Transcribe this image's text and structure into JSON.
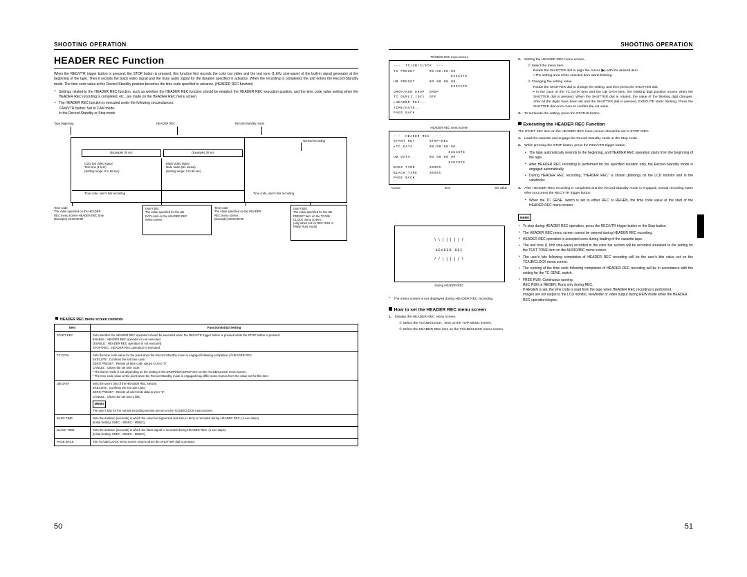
{
  "left": {
    "runhead": "SHOOTING OPERATION",
    "title": "HEADER REC Function",
    "intro": "When the REC/VTR trigger button is pressed, the STOP button is pressed, this function first records the color bar video and the test tone (1 kHz sine-wave) of the built-in signal generator at the beginning of the tape. Then it records the black video signal and the mute audio signal for the duration specified in advance. When the recording is completed, the unit enters the Record-Standby mode. The time code value at the Record-Standby position becomes the time code specified in advance. (HEADER REC function)",
    "bullets": [
      "Settings related to the HEADER REC function, such as whether the HEADER REC function should be enabled, the HEADER REC execution position, and the time code value setting when the HEADER REC recording is completed, etc., are made on the HEADER REC menu screen.",
      "The HEADER REC function is executed under the following circumstances:"
    ],
    "sub_conditions": [
      "CAM/VTR button: Set to CAM mode.",
      "In the Record-Standby or Stop mode"
    ],
    "diagram": {
      "tape_beginning": "Tape beginning",
      "header_rec": "HEADER REC",
      "record_standby": "Record-Standby mode",
      "normal_recording": "Normal recording",
      "example30a": "(Example) 30 sec",
      "example30b": "(Example) 30 sec",
      "colorbar": "Color bar video signal\nTest tone (1 kHz)\n(Setting range: 0 to 99 sec)",
      "black": "Black video signal\nMute audio (No sound)\n(Setting range: 0 to 99 sec)",
      "tc_ub_left": "Time code, user's bits recording",
      "tc_ub_right": "Time code, user's bits recording",
      "note1": "Time code:\nThe value specified on the HEADER\nREC menu screen-HEADER REC time\n(Example) 23:59:30:00",
      "note2": "User's bits:\nThe value specified for the UB\nDATA item on the HEADER REC\nmenu screen.",
      "note3": "Time code:\nThe value specified on the HEADER\nREC menu screen.\n(Example) 00:00:00:00",
      "note4": "User's bits:\nThe value specified for the UB\nPRESET item on the TC/UB/\nCLOCK menu screen.\n(only when set for REC RUN or\nFREE RUN mode)"
    },
    "table": {
      "heading": "HEADER REC menu screen contents",
      "cols": [
        "Item",
        "Function/Initial Setting"
      ],
      "rows": [
        {
          "item": "START KEY",
          "lines": [
            "Sets whether the HEADER REC operation should be executed when the REC/VTR trigger button is pressed while the STOP button is pressed.",
            "ENABLE            : HEADER REC operation is not executed.",
            "DISABLE           : HEADER REC operation is not executed.",
            "STOP+REC        : HEADER REC operation is executed."
          ]
        },
        {
          "item": "TC DATA",
          "lines": [
            "Sets the time code value for the point when the Record-Standby mode is engaged following completion of HEADER REC.",
            "EXECUTE         : Confirms the set time code.",
            "ZERO PRESET  : Resets all time code values to zero \"0\".",
            "CANCEL           : Clears the set time code.",
            "• The frame mode is set depending on the setting in the DROP/NON DROP item on the TC/UB/CLOCK menu screen.",
            "* The time code value at the point when the Record-Standby mode is engaged may differ some frames from the value set for this item."
          ]
        },
        {
          "item": "UB DATA",
          "lines": [
            "Sets the user's bits of the HEADER REC section.",
            "EXECUTE         : Confirms the set user's bits.",
            "ZERO PRESET  : Resets all user's bits data to zero \"0\".",
            "CANCEL           : Clears the set user's bits.",
            "MEMO",
            "The user's bits for the normal recording section are set on the TC/UB/CLOCK menu screen."
          ]
        },
        {
          "item": "BARS TIME",
          "lines": [
            "Sets the duration (seconds) in which the color bar signal and test tone (1 kHz) is recorded during HEADER REC. (1-sec steps)",
            "[Initial Setting: 0SEC - 30SEC - 99SEC]"
          ]
        },
        {
          "item": "BLACK TIME",
          "lines": [
            "Sets the duration (seconds) in which the black signal is recorded during HEADER REC. (1-sec steps)",
            "[Initial Setting: 0SEC - 30SEC - 99SEC]"
          ]
        },
        {
          "item": "PAGE BACK",
          "lines": [
            "The TC/UB/CLOCK menu screen returns when the SHUTTER dial is pressed."
          ]
        }
      ]
    },
    "folio": "50"
  },
  "right": {
    "runhead": "SHOOTING OPERATION",
    "screen1": {
      "caption": "TC/UB/CLOCK menu screen",
      "text": "---  TC/UB/CLOCK  ---\nTC PRESET      00:00:00:00\n                        EXECUTE\nUB PRESET      00 00 00 00\n                        EXECUTE\nDROP/NON DROP  DROP\nTC DUPLI.(DV)  OFF\n▸HEADER REC...\nTIME/DATE..\nPAGE BACK"
    },
    "screen2": {
      "caption": "HEADER REC menu screen",
      "text": "---  HEADER REC  ---\nSTART KEY      STOP+REC\n▸TC DATA       00:00:00:00\n                       EXECUTE\nUB DATA        00 00 00 00\n                       EXECUTE\nBARS TIME      30SEC\nBLACK TIME     30SEC\nPAGE BACK"
    },
    "screen_labels": {
      "cursor": "Cursor",
      "item": "Item",
      "setvalue": "Set value"
    },
    "viewfinder": {
      "text": "HEADER REC",
      "caption": "During HEADER REC"
    },
    "steps_left": [
      {
        "n": "2.",
        "text": "Setting the HEADER REC menu screen.",
        "subs": [
          {
            "c": "1",
            "t": "Select the menu item.",
            "lines": [
              "Rotate the SHUTTER dial to align the cursor (▶) with the desired item.",
              "• The setting area of the selected item starts blinking."
            ]
          },
          {
            "c": "2",
            "t": "Changing the setting value.",
            "lines": [
              "Rotate the SHUTTER dial to change the setting, and then press the SHUTTER dial.",
              "• In the case of the TC DATA item and the UB DATA item, the blinking digit position moves when the SHUTTER dial is pressed. When the SHUTTER dial is rotated, the value of the blinking digit changes. After all the digits have been set and the SHUTTER dial is pressed, EXECUTE starts blinking. Press the SHUTTER dial once more to confirm the set value."
            ]
          }
        ]
      },
      {
        "n": "3.",
        "text": "To terminate the setting, press the STATUS button.",
        "subs": []
      }
    ],
    "section1": {
      "heading": "Executing the HEADER REC Function",
      "intro": "The START KEY item on the HEADER REC menu screen should be set to STOP+REC.",
      "steps": [
        {
          "n": "1.",
          "text": "Load the cassette and engage the Record-Standby mode or the Stop mode.",
          "bullets": []
        },
        {
          "n": "2.",
          "text": "While pressing the STOP button, press the REC/VTR trigger button.",
          "bullets": [
            "The tape automatically rewinds to the beginning, and HEADER REC operation starts from the beginning of the tape.",
            "After HEADER REC recording is performed for the specified duration only, the Record-Standby mode is engaged automatically.",
            "During HEADER REC recording, \"HEADER REC\" is shown (blinking) on the LCD monitor and in the viewfinder."
          ]
        },
        {
          "n": "3.",
          "text": "After HEADER REC recording is completed and the Record-Standby mode is engaged, normal recording starts when you press the REC/VTR trigger button.",
          "bullets": [
            "When the TC GENE. switch is set to either REC or REGEN, the time code value at the start of the HEADER REC menu screen."
          ]
        }
      ]
    },
    "memo": {
      "title": "MEMO",
      "items": [
        "To stop during HEADER REC operation, press the REC/VTR trigger button or the Stop button.",
        "The HEADER REC menu screen cannot be opened during HEADER REC recording.",
        "HEADER REC operation is accepted even during loading of the cassette tape.",
        "The test tone (1 kHz sine-wave) recorded in the color bar section will be recorded unrelated to the setting for the TEST TONE item on the AUDIO/MIC menu screen.",
        "The user's bits following completion of HEADER REC recording will be the user's bits value set on the TC/UB/CLOCK menu screen.",
        "The running of the time code following completion of HEADER REC recording will be in accordance with the setting for the TC GENE. switch.",
        "FREE RUN: Continuous running.",
        "REC RUN or REGEN: Runs only during REC.",
        "If REGEN is set, the time code is read from the tape when HEADER REC recording is performed.",
        "Images are not output to the LCD monitor, viewfinder or video output during REW mode when the HEADER REC operation begins."
      ]
    },
    "note_menu": "The menu screen is not displayed during HEADER REC recording.",
    "section2": {
      "heading": "How to set the HEADER REC menu screen",
      "steps": [
        {
          "n": "1.",
          "text": "Display the HEADER REC menu screen.",
          "subs": [
            {
              "c": "1",
              "t": "Select the TC/UB/CLOCK.. item on the TOP MENU screen."
            },
            {
              "c": "2",
              "t": "Select the HEADER REC item on the TC/UB/CLOCK menu screen."
            }
          ]
        }
      ]
    },
    "folio": "51"
  }
}
